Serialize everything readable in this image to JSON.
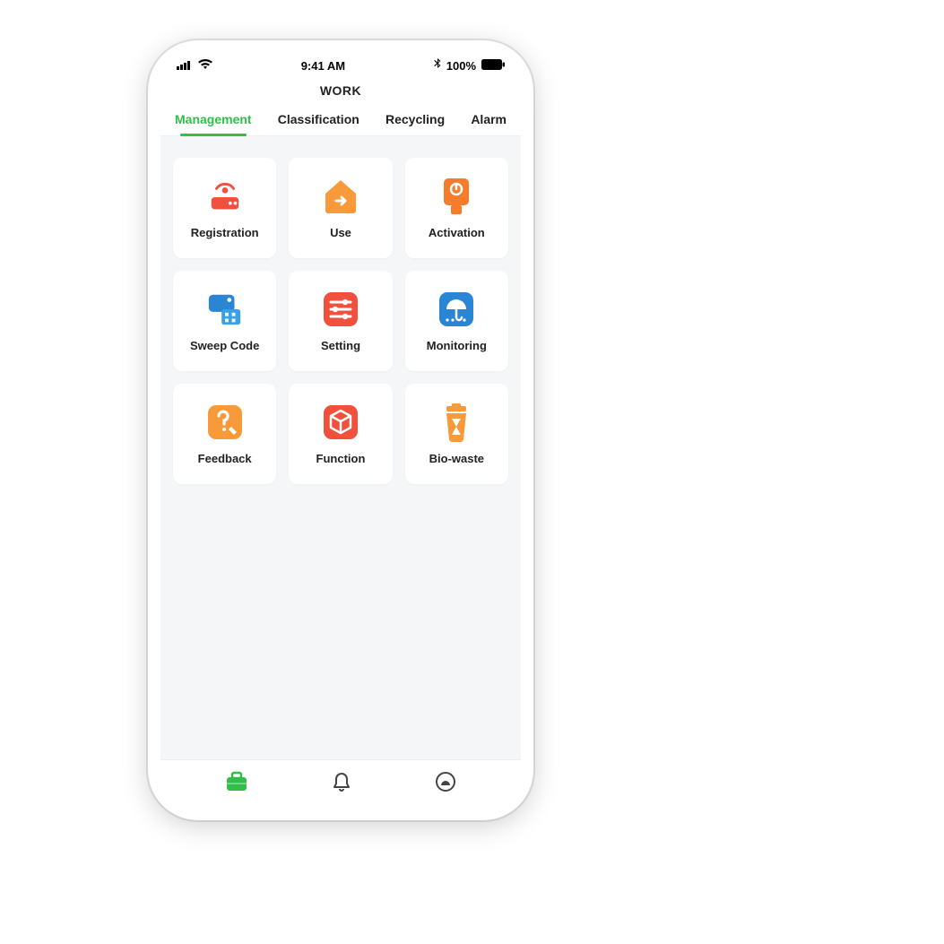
{
  "status_bar": {
    "time": "9:41 AM",
    "battery": "100%"
  },
  "header": {
    "title": "WORK"
  },
  "tabs": [
    {
      "label": "Management",
      "active": true
    },
    {
      "label": "Classification",
      "active": false
    },
    {
      "label": "Recycling",
      "active": false
    },
    {
      "label": "Alarm",
      "active": false
    }
  ],
  "grid": {
    "items": [
      {
        "label": "Registration",
        "icon": "router-icon"
      },
      {
        "label": "Use",
        "icon": "home-arrow-icon"
      },
      {
        "label": "Activation",
        "icon": "lamp-icon"
      },
      {
        "label": "Sweep Code",
        "icon": "printer-icon"
      },
      {
        "label": "Setting",
        "icon": "sliders-icon"
      },
      {
        "label": "Monitoring",
        "icon": "umbrella-icon"
      },
      {
        "label": "Feedback",
        "icon": "question-edit-icon"
      },
      {
        "label": "Function",
        "icon": "cube-icon"
      },
      {
        "label": "Bio-waste",
        "icon": "trash-hourglass-icon"
      }
    ]
  },
  "bottom_nav": {
    "items": [
      "briefcase",
      "bell",
      "profile"
    ]
  },
  "colors": {
    "accent": "#2fbf4a",
    "orange1": "#f57c2b",
    "orange2": "#f89a3a",
    "red": "#f0503c",
    "blue": "#2a86d4",
    "blue2": "#3aa0e8"
  }
}
